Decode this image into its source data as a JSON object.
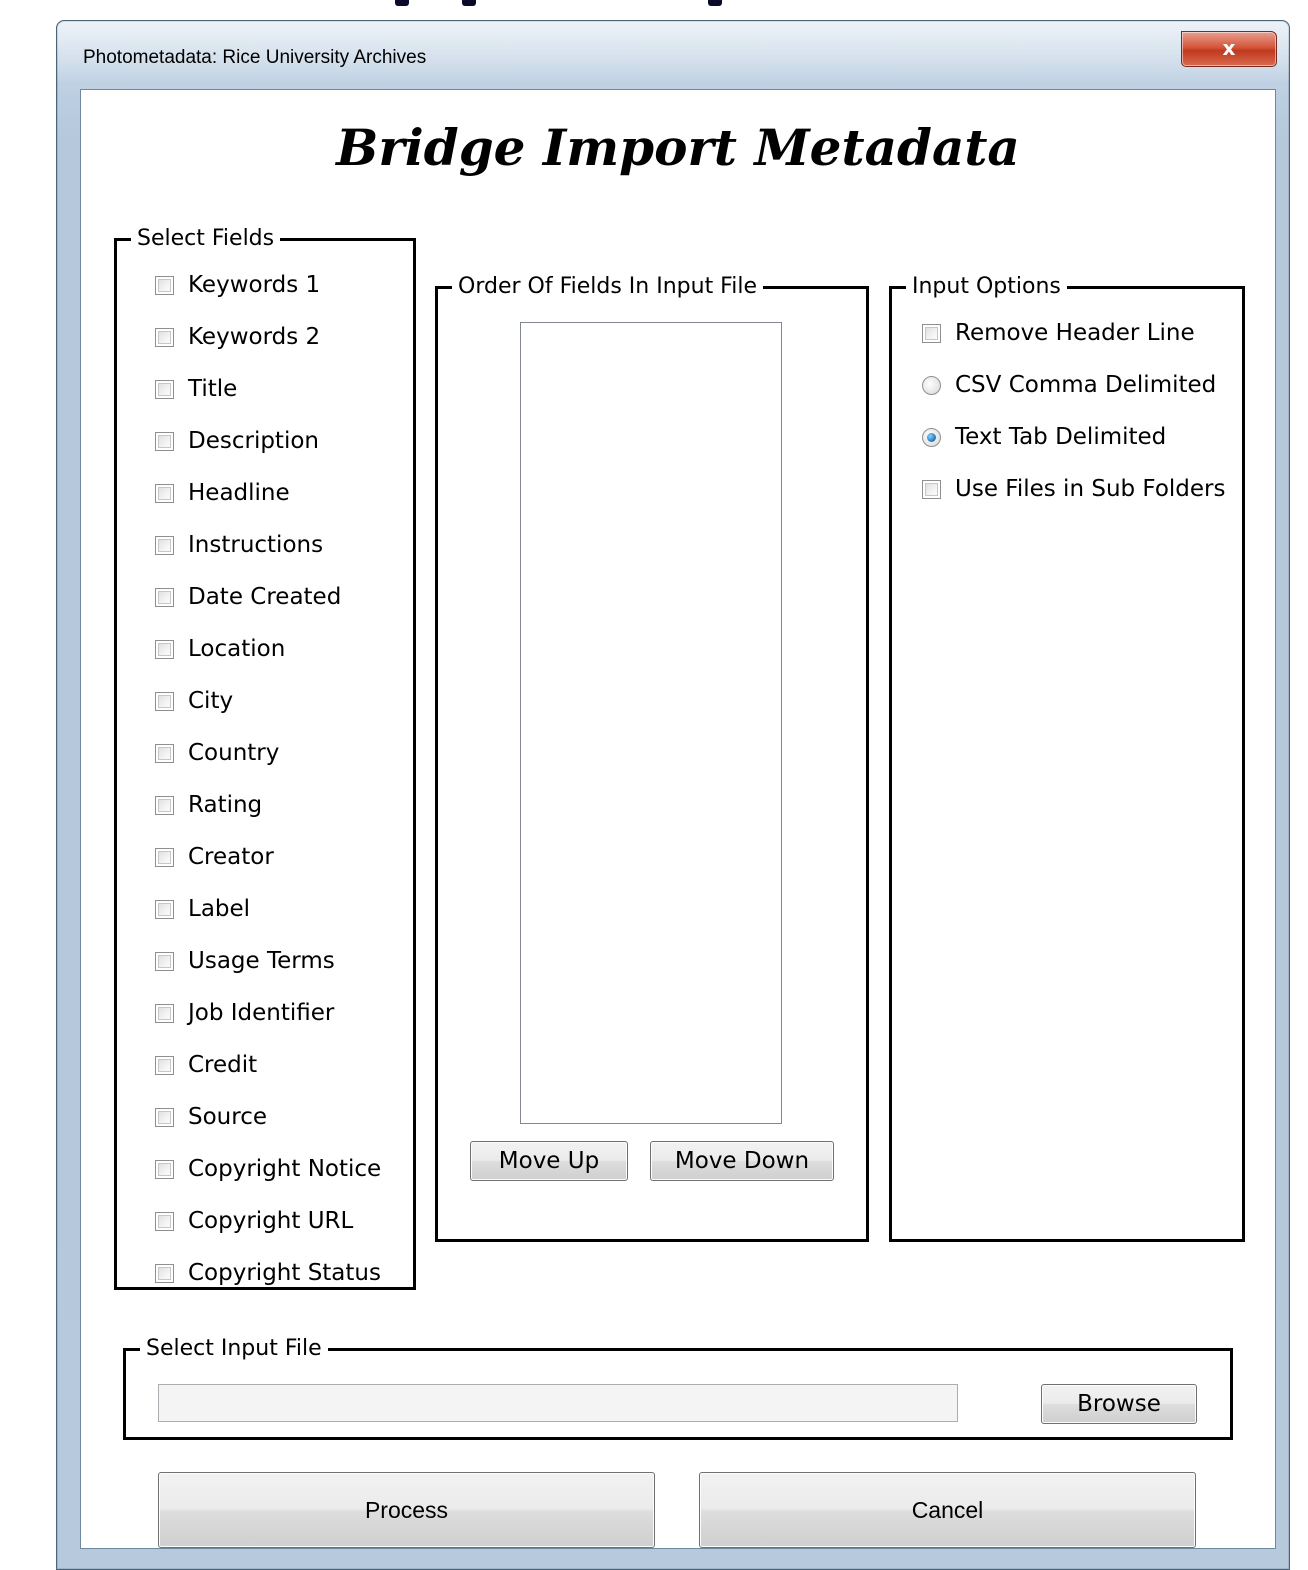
{
  "window": {
    "title": "Photometadata: Rice University Archives",
    "close_label": "x"
  },
  "heading": "Bridge Import Metadata",
  "select_fields": {
    "legend": "Select Fields",
    "items": [
      {
        "label": "Keywords 1",
        "checked": false
      },
      {
        "label": "Keywords 2",
        "checked": false
      },
      {
        "label": "Title",
        "checked": false
      },
      {
        "label": "Description",
        "checked": false
      },
      {
        "label": "Headline",
        "checked": false
      },
      {
        "label": "Instructions",
        "checked": false
      },
      {
        "label": "Date Created",
        "checked": false
      },
      {
        "label": "Location",
        "checked": false
      },
      {
        "label": "City",
        "checked": false
      },
      {
        "label": "Country",
        "checked": false
      },
      {
        "label": "Rating",
        "checked": false
      },
      {
        "label": "Creator",
        "checked": false
      },
      {
        "label": "Label",
        "checked": false
      },
      {
        "label": "Usage Terms",
        "checked": false
      },
      {
        "label": "Job Identifier",
        "checked": false
      },
      {
        "label": "Credit",
        "checked": false
      },
      {
        "label": "Source",
        "checked": false
      },
      {
        "label": "Copyright Notice",
        "checked": false
      },
      {
        "label": "Copyright URL",
        "checked": false
      },
      {
        "label": "Copyright Status",
        "checked": false
      }
    ]
  },
  "order_fields": {
    "legend": "Order Of Fields In Input File",
    "items": [],
    "move_up_label": "Move Up",
    "move_down_label": "Move Down"
  },
  "input_options": {
    "legend": "Input Options",
    "remove_header_line": {
      "label": "Remove Header Line",
      "checked": false
    },
    "csv_comma": {
      "label": "CSV Comma Delimited",
      "selected": false
    },
    "text_tab": {
      "label": "Text Tab Delimited",
      "selected": true
    },
    "sub_folders": {
      "label": "Use Files in Sub Folders",
      "checked": false
    }
  },
  "input_file": {
    "legend": "Select Input File",
    "value": "",
    "browse_label": "Browse"
  },
  "actions": {
    "process_label": "Process",
    "cancel_label": "Cancel"
  }
}
